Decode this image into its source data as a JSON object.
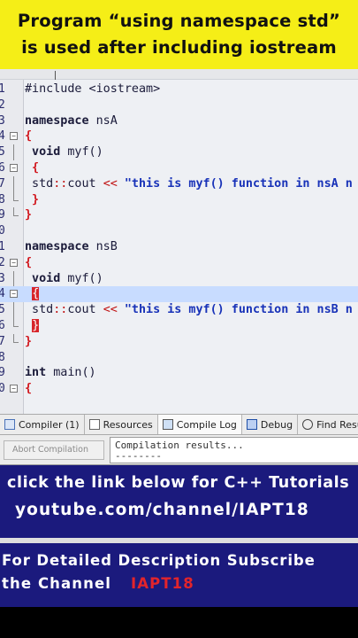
{
  "caption": {
    "line1": "Program “using namespace std”",
    "line2": "is used after including iostream"
  },
  "editor": {
    "lines": [
      {
        "n": "1",
        "fold": "",
        "segs": [
          {
            "t": "#include <iostream>",
            "c": ""
          }
        ]
      },
      {
        "n": "2",
        "fold": "",
        "segs": []
      },
      {
        "n": "3",
        "fold": "",
        "segs": [
          {
            "t": "namespace",
            "c": "kw"
          },
          {
            "t": " nsA",
            "c": ""
          }
        ]
      },
      {
        "n": "4",
        "fold": "box",
        "segs": [
          {
            "t": "{",
            "c": "brace"
          }
        ]
      },
      {
        "n": "5",
        "fold": "guide",
        "segs": [
          {
            "t": " void",
            "c": "kw"
          },
          {
            "t": " myf()",
            "c": ""
          }
        ]
      },
      {
        "n": "6",
        "fold": "box",
        "segs": [
          {
            "t": " {",
            "c": "brace"
          }
        ]
      },
      {
        "n": "7",
        "fold": "guide",
        "segs": [
          {
            "t": " std",
            "c": ""
          },
          {
            "t": "::",
            "c": "op"
          },
          {
            "t": "cout ",
            "c": ""
          },
          {
            "t": "<<",
            "c": "op"
          },
          {
            "t": " \"this is myf() function in nsA n",
            "c": "str"
          }
        ]
      },
      {
        "n": "8",
        "fold": "end",
        "segs": [
          {
            "t": " }",
            "c": "brace"
          }
        ]
      },
      {
        "n": "9",
        "fold": "end",
        "segs": [
          {
            "t": "}",
            "c": "brace"
          }
        ]
      },
      {
        "n": "0",
        "fold": "",
        "segs": []
      },
      {
        "n": "1",
        "fold": "",
        "segs": [
          {
            "t": "namespace",
            "c": "kw"
          },
          {
            "t": " nsB",
            "c": ""
          }
        ]
      },
      {
        "n": "2",
        "fold": "box",
        "segs": [
          {
            "t": "{",
            "c": "brace"
          }
        ]
      },
      {
        "n": "3",
        "fold": "guide",
        "segs": [
          {
            "t": " void",
            "c": "kw"
          },
          {
            "t": " myf()",
            "c": ""
          }
        ]
      },
      {
        "n": "4",
        "fold": "box",
        "hl": true,
        "segs": [
          {
            "t": " ",
            "c": ""
          },
          {
            "t": "{",
            "c": "brace-hl"
          }
        ]
      },
      {
        "n": "5",
        "fold": "guide",
        "segs": [
          {
            "t": " std",
            "c": ""
          },
          {
            "t": "::",
            "c": "op"
          },
          {
            "t": "cout ",
            "c": ""
          },
          {
            "t": "<<",
            "c": "op"
          },
          {
            "t": " \"this is myf() function in nsB n",
            "c": "str"
          }
        ]
      },
      {
        "n": "6",
        "fold": "end",
        "segs": [
          {
            "t": " ",
            "c": ""
          },
          {
            "t": "}",
            "c": "brace-hl"
          }
        ]
      },
      {
        "n": "7",
        "fold": "end",
        "segs": [
          {
            "t": "}",
            "c": "brace"
          }
        ]
      },
      {
        "n": "8",
        "fold": "",
        "segs": []
      },
      {
        "n": "9",
        "fold": "",
        "segs": [
          {
            "t": "int",
            "c": "kw"
          },
          {
            "t": " main()",
            "c": ""
          }
        ]
      },
      {
        "n": "0",
        "fold": "box",
        "segs": [
          {
            "t": "{",
            "c": "brace"
          }
        ]
      }
    ]
  },
  "tabs": [
    {
      "label": "Compiler (1)",
      "icon": "compiler-icon",
      "active": false
    },
    {
      "label": "Resources",
      "icon": "resources-icon",
      "active": false
    },
    {
      "label": "Compile Log",
      "icon": "compile-log-icon",
      "active": true
    },
    {
      "label": "Debug",
      "icon": "debug-icon",
      "active": false
    },
    {
      "label": "Find Results",
      "icon": "find-icon",
      "active": false
    }
  ],
  "log": {
    "abort_label": "Abort Compilation",
    "output": "Compilation results...\n--------"
  },
  "banner1": {
    "line1": "click the link below for C++ Tutorials",
    "line2": "youtube.com/channel/IAPT18"
  },
  "banner2": {
    "line1": "For Detailed Description Subscribe",
    "line2": "the Channel",
    "accent": "IAPT18"
  },
  "colors": {
    "caption_bg": "#f5ee17",
    "banner_bg": "#1b1a7d",
    "accent_red": "#e2242b",
    "string_blue": "#1832b8"
  }
}
